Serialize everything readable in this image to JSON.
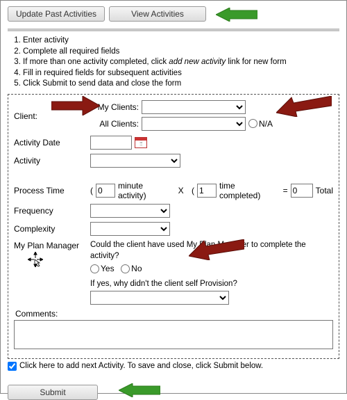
{
  "buttons": {
    "update_past": "Update Past Activities",
    "view_activities": "View Activities",
    "submit": "Submit"
  },
  "instructions": {
    "i1": "Enter activity",
    "i2": "Complete all required fields",
    "i3a": "If more than one activity completed, click ",
    "i3b": "add new activity",
    "i3c": " link for new form",
    "i4": "Fill in required fields for subsequent activities",
    "i5": "Click Submit to send data and close the form"
  },
  "form": {
    "client_label": "Client:",
    "my_clients_label": "My Clients:",
    "all_clients_label": "All Clients:",
    "na_label": "N/A",
    "activity_date_label": "Activity Date",
    "activity_label": "Activity",
    "process_time_label": "Process Time",
    "proc_open": "(",
    "proc_min_val": "0",
    "proc_min_txt": "minute activity)",
    "proc_x": "X",
    "proc_open2": "(",
    "proc_times_val": "1",
    "proc_times_txt": "time completed)",
    "proc_eq": "=",
    "proc_total_val": "0",
    "proc_total_txt": "Total",
    "frequency_label": "Frequency",
    "complexity_label": "Complexity",
    "mpm_label": "My Plan Manager",
    "mpm_q1": "Could the client have used My Plan Manager to complete the activity?",
    "yes": "Yes",
    "no": "No",
    "mpm_q2": "If yes, why didn't the client self Provision?",
    "comments_label": "Comments:",
    "add_next_label": "Click here to add next Activity. To save and close, click Submit below."
  }
}
